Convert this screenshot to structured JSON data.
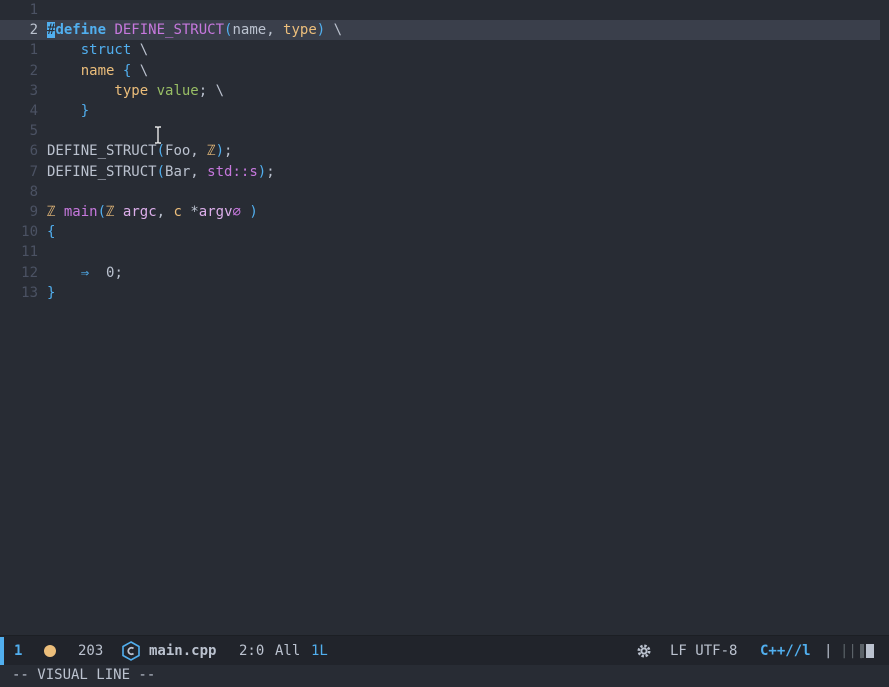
{
  "editor": {
    "lines": [
      {
        "num": "1",
        "tokens": []
      },
      {
        "num": "2",
        "current": true,
        "tokens": [
          {
            "t": "#",
            "c": "cursor"
          },
          {
            "t": "define",
            "c": "kw bold"
          },
          {
            "t": " ",
            "c": "id"
          },
          {
            "t": "DEFINE_STRUCT",
            "c": "fn"
          },
          {
            "t": "(",
            "c": "brk"
          },
          {
            "t": "name",
            "c": "id"
          },
          {
            "t": ", ",
            "c": "id"
          },
          {
            "t": "type",
            "c": "ty"
          },
          {
            "t": ")",
            "c": "brk"
          },
          {
            "t": " \\",
            "c": "id"
          }
        ]
      },
      {
        "num": "1",
        "tokens": [
          {
            "t": "    struct",
            "c": "kw"
          },
          {
            "t": " \\",
            "c": "id"
          }
        ]
      },
      {
        "num": "2",
        "tokens": [
          {
            "t": "    name",
            "c": "ty"
          },
          {
            "t": " ",
            "c": "id"
          },
          {
            "t": "{",
            "c": "brk"
          },
          {
            "t": " \\",
            "c": "id"
          }
        ]
      },
      {
        "num": "3",
        "tokens": [
          {
            "t": "        type",
            "c": "ty"
          },
          {
            "t": " ",
            "c": "id"
          },
          {
            "t": "value",
            "c": "vn"
          },
          {
            "t": "; \\",
            "c": "id"
          }
        ]
      },
      {
        "num": "4",
        "tokens": [
          {
            "t": "    }",
            "c": "brk"
          }
        ]
      },
      {
        "num": "5",
        "tokens": []
      },
      {
        "num": "6",
        "tokens": [
          {
            "t": "DEFINE_STRUCT",
            "c": "id"
          },
          {
            "t": "(",
            "c": "brk"
          },
          {
            "t": "Foo, ",
            "c": "id"
          },
          {
            "t": "ℤ",
            "c": "sym"
          },
          {
            "t": ")",
            "c": "brk"
          },
          {
            "t": ";",
            "c": "id"
          }
        ]
      },
      {
        "num": "7",
        "tokens": [
          {
            "t": "DEFINE_STRUCT",
            "c": "id"
          },
          {
            "t": "(",
            "c": "brk"
          },
          {
            "t": "Bar, ",
            "c": "id"
          },
          {
            "t": "std::s",
            "c": "fn"
          },
          {
            "t": ")",
            "c": "brk"
          },
          {
            "t": ";",
            "c": "id"
          }
        ]
      },
      {
        "num": "8",
        "tokens": []
      },
      {
        "num": "9",
        "tokens": [
          {
            "t": "ℤ",
            "c": "sym"
          },
          {
            "t": " ",
            "c": "id"
          },
          {
            "t": "main",
            "c": "fn"
          },
          {
            "t": "(",
            "c": "brk"
          },
          {
            "t": "ℤ",
            "c": "sym"
          },
          {
            "t": " ",
            "c": "id"
          },
          {
            "t": "argc",
            "c": "var"
          },
          {
            "t": ", ",
            "c": "id"
          },
          {
            "t": "c",
            "c": "sym"
          },
          {
            "t": " *",
            "c": "id"
          },
          {
            "t": "argv",
            "c": "var"
          },
          {
            "t": "∅",
            "c": "fn"
          },
          {
            "t": " )",
            "c": "brk"
          }
        ]
      },
      {
        "num": "10",
        "tokens": [
          {
            "t": "{",
            "c": "brk"
          }
        ]
      },
      {
        "num": "11",
        "tokens": []
      },
      {
        "num": "12",
        "tokens": [
          {
            "t": "    ⇒",
            "c": "kw"
          },
          {
            "t": "  0;",
            "c": "id"
          }
        ]
      },
      {
        "num": "13",
        "tokens": [
          {
            "t": "}",
            "c": "brk"
          }
        ]
      }
    ]
  },
  "modeline": {
    "window_number": "1",
    "line_count": "203",
    "file_icon": "c-plus-plus-icon",
    "file_name": "main.cpp",
    "position": "2:0",
    "scroll": "All",
    "selection": "1L",
    "settings_icon": "gear-icon",
    "encoding": "LF UTF-8",
    "major_mode": "C++//l",
    "sep": "|",
    "extra": "|||"
  },
  "echo": {
    "text": "-- VISUAL LINE --"
  },
  "colors": {
    "background": "#282c34",
    "accent": "#51afef",
    "keyword": "#51afef",
    "function": "#c678dd",
    "type": "#ecbe7b",
    "modified_dot": "#ecbe7b"
  }
}
